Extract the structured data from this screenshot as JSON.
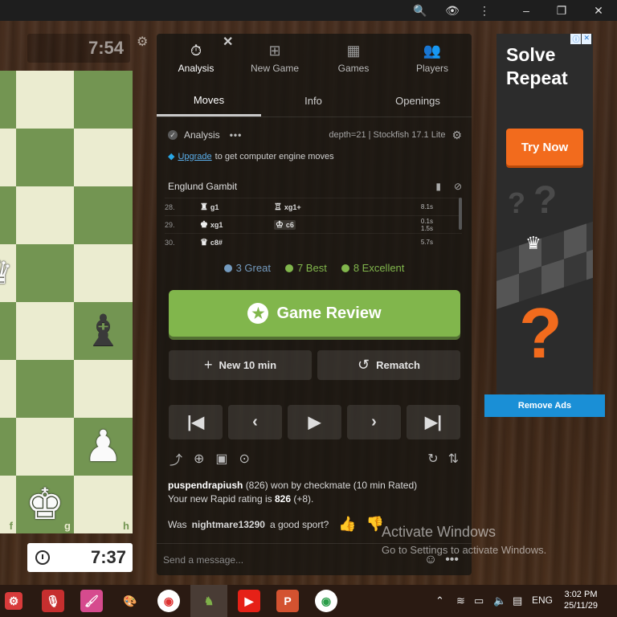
{
  "window_controls": {
    "zoom": "🔍",
    "eye": "👁",
    "more": "⋮",
    "minimize": "–",
    "restore": "❐",
    "close": "✕"
  },
  "clocks": {
    "opponent": "7:54",
    "player": "7:37"
  },
  "board": {
    "coord_f": "f",
    "coord_g": "g",
    "coord_h": "h"
  },
  "top_tabs": [
    {
      "label": "Analysis",
      "icon": "⏱"
    },
    {
      "label": "New Game",
      "icon": "⊞"
    },
    {
      "label": "Games",
      "icon": "▦"
    },
    {
      "label": "Players",
      "icon": "👥"
    }
  ],
  "sub_tabs": [
    "Moves",
    "Info",
    "Openings"
  ],
  "analysis": {
    "label": "Analysis",
    "dots": "•••",
    "depth": "depth=21  |  Stockfish 17.1 Lite"
  },
  "upgrade": {
    "link": "Upgrade",
    "text": "to get computer engine moves"
  },
  "opening": {
    "name": "Englund Gambit"
  },
  "moves": [
    {
      "num": "28.",
      "white_piece": "♜",
      "white": "g1",
      "black_piece": "♖",
      "black": "xg1+",
      "t1": "8.1s",
      "t2": ""
    },
    {
      "num": "29.",
      "white_piece": "♚",
      "white": "xg1",
      "black_piece": "♔",
      "black": "c6",
      "t1": "0.1s",
      "t2": "1.5s"
    },
    {
      "num": "30.",
      "white_piece": "♛",
      "white": "c8#",
      "black_piece": "",
      "black": "",
      "t1": "5.7s",
      "t2": ""
    }
  ],
  "badges": [
    {
      "label": "3 Great",
      "color": "#749bbf"
    },
    {
      "label": "7 Best",
      "color": "#81b64c"
    },
    {
      "label": "8 Excellent",
      "color": "#81b64c"
    }
  ],
  "review_button": {
    "label": "Game Review",
    "icon": "★"
  },
  "new_game_button": {
    "label": "New 10 min",
    "icon": "+"
  },
  "rematch_button": {
    "label": "Rematch",
    "icon": "↺"
  },
  "nav": {
    "first": "|◀",
    "prev": "‹",
    "play": "▶",
    "next": "›",
    "last": "▶|"
  },
  "result": {
    "winner": "puspendrapiush",
    "text": "(826) won by checkmate (10 min Rated)",
    "rating_prefix": "Your new Rapid rating is",
    "rating": "826",
    "rating_change": "(+8)."
  },
  "sport": {
    "prefix": "Was",
    "opponent": "nightmare13290",
    "suffix": "a good sport?"
  },
  "message": {
    "placeholder": "Send a message..."
  },
  "activate_windows": {
    "line1": "Activate Windows",
    "line2": "Go to Settings to activate Windows."
  },
  "ad": {
    "title": "Solve Repeat",
    "cta": "Try Now",
    "remove": "Remove Ads"
  },
  "taskbar": {
    "lang": "ENG",
    "time": "3:02 PM",
    "date": "25/11/29"
  }
}
